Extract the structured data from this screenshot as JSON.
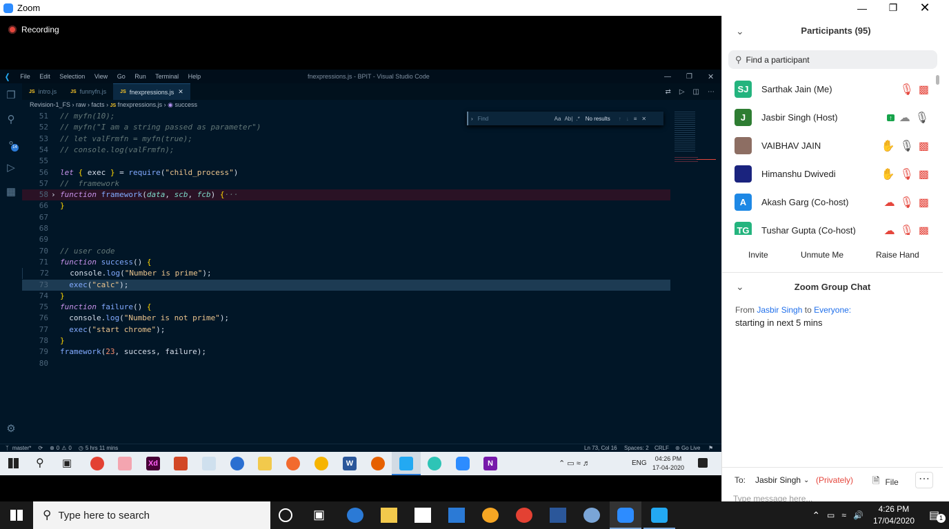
{
  "zoom_window": {
    "title": "Zoom",
    "recording_label": "Recording"
  },
  "vscode": {
    "menu": [
      "File",
      "Edit",
      "Selection",
      "View",
      "Go",
      "Run",
      "Terminal",
      "Help"
    ],
    "window_title": "fnexpressions.js - BPIT - Visual Studio Code",
    "tabs": [
      {
        "label": "intro.js",
        "active": false
      },
      {
        "label": "funnyfn.js",
        "active": false
      },
      {
        "label": "fnexpressions.js",
        "active": true
      }
    ],
    "breadcrumb": [
      "Revision-1_FS",
      "raw",
      "facts",
      "fnexpressions.js",
      "success"
    ],
    "source_control_badge": "14",
    "find": {
      "placeholder": "Find",
      "result": "No results",
      "options": [
        "Aa",
        "Ab|",
        ".*"
      ]
    },
    "code_lines": [
      {
        "n": "51",
        "html": "<span class='c-com'>// myfn(10);</span>"
      },
      {
        "n": "52",
        "html": "<span class='c-com'>// myfn(\"I am a string passed as parameter\")</span>"
      },
      {
        "n": "53",
        "html": "<span class='c-com'>// let valFrmfn = myfn(true);</span>"
      },
      {
        "n": "54",
        "html": "<span class='c-com'>// console.log(valFrmfn);</span>"
      },
      {
        "n": "55",
        "html": ""
      },
      {
        "n": "56",
        "html": "<span class='c-kw'>let</span> <span class='c-brk'>{</span> exec <span class='c-brk'>}</span> = <span class='c-fn'>require</span>(<span class='c-str'>\"child_process\"</span>)"
      },
      {
        "n": "57",
        "html": "<span class='c-com'>//  framework</span>"
      },
      {
        "n": "58",
        "html": "<span class='c-kw'>function</span> <span class='c-fn'>framework</span>(<span class='c-par'>data</span>, <span class='c-par'>scb</span>, <span class='c-par'>fcb</span>) <span class='c-brk'>{</span><span class='c-com'>&#183;&#183;&#183;</span>"
      },
      {
        "n": "66",
        "html": "<span class='c-brk'>}</span>"
      },
      {
        "n": "67",
        "html": ""
      },
      {
        "n": "68",
        "html": ""
      },
      {
        "n": "69",
        "html": ""
      },
      {
        "n": "70",
        "html": "<span class='c-com'>// user code</span>"
      },
      {
        "n": "71",
        "html": "<span class='c-kw'>function</span> <span class='c-fn'>success</span>() <span class='c-brk'>{</span>"
      },
      {
        "n": "72",
        "html": "  console.<span class='c-fn'>log</span>(<span class='c-str'>\"Number is prime\"</span>);"
      },
      {
        "n": "73",
        "html": "  <span class='c-fn'>exec</span>(<span class='c-str'>\"calc\"</span>);"
      },
      {
        "n": "74",
        "html": "<span class='c-brk'>}</span>"
      },
      {
        "n": "75",
        "html": "<span class='c-kw'>function</span> <span class='c-fn'>failure</span>() <span class='c-brk'>{</span>"
      },
      {
        "n": "76",
        "html": "  console.<span class='c-fn'>log</span>(<span class='c-str'>\"Number is not prime\"</span>);"
      },
      {
        "n": "77",
        "html": "  <span class='c-fn'>exec</span>(<span class='c-str'>\"start chrome\"</span>);"
      },
      {
        "n": "78",
        "html": "<span class='c-brk'>}</span>"
      },
      {
        "n": "79",
        "html": "<span class='c-fn'>framework</span>(<span class='c-num'>23</span>, success, failure);"
      },
      {
        "n": "80",
        "html": ""
      }
    ],
    "status": {
      "branch": "master*",
      "problems": "0",
      "warnings": "0",
      "time": "5 hrs 11 mins",
      "position": "Ln 73, Col 16",
      "spaces": "Spaces: 2",
      "eol": "CRLF",
      "golive": "Go Live"
    }
  },
  "inner_taskbar": {
    "tray_lang": "ENG",
    "time": "04:26 PM",
    "date": "17-04-2020"
  },
  "participants": {
    "title": "Participants (95)",
    "search_placeholder": "Find a participant",
    "list": [
      {
        "initials": "SJ",
        "name": "Sarthak Jain (Me)",
        "color": "#24b47e"
      },
      {
        "initials": "J",
        "name": "Jasbir Singh (Host)",
        "color": "#2e7d32"
      },
      {
        "initials": "",
        "name": "VAIBHAV JAIN",
        "color": "#8d6e63"
      },
      {
        "initials": "",
        "name": "Himanshu Dwivedi",
        "color": "#1a237e"
      },
      {
        "initials": "A",
        "name": "Akash Garg (Co-host)",
        "color": "#1e88e5"
      },
      {
        "initials": "TG",
        "name": "Tushar Gupta (Co-host)",
        "color": "#24b47e"
      }
    ],
    "buttons": {
      "invite": "Invite",
      "unmute": "Unmute Me",
      "raise_hand": "Raise Hand"
    }
  },
  "chat": {
    "title": "Zoom Group Chat",
    "from_label": "From",
    "sender": "Jasbir Singh",
    "to_label": "to",
    "recipient": "Everyone:",
    "message": "starting in next 5 mins",
    "to_prefix": "To:",
    "to_value": "Jasbir Singh",
    "privately": "(Privately)",
    "file_label": "File",
    "input_placeholder": "Type message here..."
  },
  "windows_taskbar": {
    "search_placeholder": "Type here to search",
    "time": "4:26 PM",
    "date": "17/04/2020",
    "notifications": "1"
  }
}
